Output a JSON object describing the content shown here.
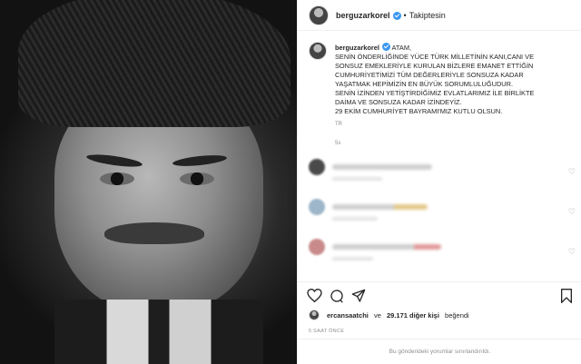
{
  "post": {
    "username": "berguzarkorel",
    "follow_status": "Takiptesin",
    "dot": "•"
  },
  "caption": {
    "username": "berguzarkorel",
    "first": "ATAM,",
    "lines": [
      "SENİN ÖNDERLİĞİNDE YÜCE TÜRK MİLLETİNİN KANI,CANI VE",
      "SONSUZ EMEKLERİYLE KURULAN BİZLERE EMANET ETTİĞİN",
      "CUMHURİYETİMİZİ TÜM DEĞERLERİYLE SONSUZA KADAR",
      "YAŞATMAK HEPİMİZİN EN BÜYÜK SORUMLULUĞUDUR.",
      "SENİN İZİNDEN YETİŞTİRDİĞİMİZ EVLATLARIMIZ İLE BİRLİKTE",
      "DAİMA VE SONSUZA KADAR İZİNDEYİZ.",
      "29 EKİM CUMHURİYET BAYRAMI'MIZ KUTLU OLSUN."
    ],
    "hashtag": "TR",
    "time": "5s"
  },
  "likes": {
    "user": "ercansaatchi",
    "connector": "ve",
    "count_text": "29.171 diğer kişi",
    "suffix": "beğendi"
  },
  "posted_ago": "5 SAAT ÖNCE",
  "comments_disabled": "Bu gönderideki yorumlar sınırlandırıldı.",
  "colors": {
    "verified": "#3897f0",
    "muted": "#8e8e8e",
    "text": "#262626"
  }
}
